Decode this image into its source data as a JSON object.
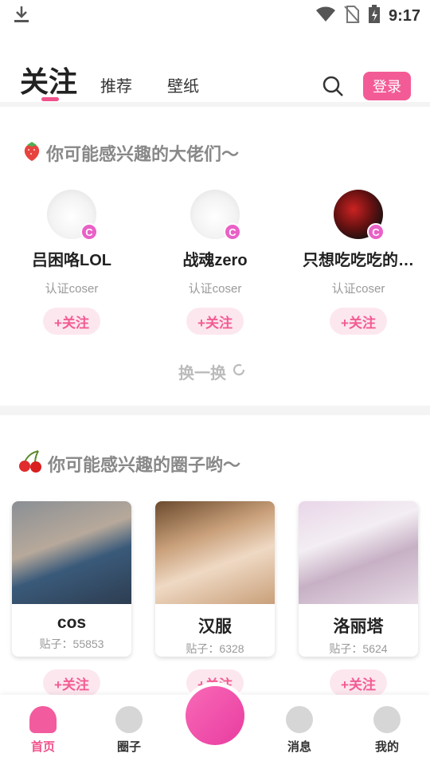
{
  "status": {
    "time": "9:17"
  },
  "tabs": {
    "main": "关注",
    "recommend": "推荐",
    "wallpaper": "壁纸",
    "login": "登录"
  },
  "section1": {
    "title": "你可能感兴趣的大佬们～"
  },
  "users": [
    {
      "name": "吕困咯LOL",
      "sub": "认证coser",
      "follow": "+关注",
      "badge": "C"
    },
    {
      "name": "战魂zero",
      "sub": "认证coser",
      "follow": "+关注",
      "badge": "C"
    },
    {
      "name": "只想吃吃吃的…",
      "sub": "认证coser",
      "follow": "+关注",
      "badge": "C"
    }
  ],
  "refresh": "换一换",
  "section2": {
    "title": "你可能感兴趣的圈子哟～"
  },
  "circles": [
    {
      "name": "cos",
      "count": "贴子：55853",
      "follow": "+关注"
    },
    {
      "name": "汉服",
      "count": "贴子：6328",
      "follow": "+关注"
    },
    {
      "name": "洛丽塔",
      "count": "贴子：5624",
      "follow": "+关注"
    }
  ],
  "nav": {
    "home": "首页",
    "circle": "圈子",
    "message": "消息",
    "mine": "我的"
  },
  "colors": {
    "accent": "#f0528c",
    "login_bg": "#f35b96",
    "badge": "#e961c7"
  }
}
